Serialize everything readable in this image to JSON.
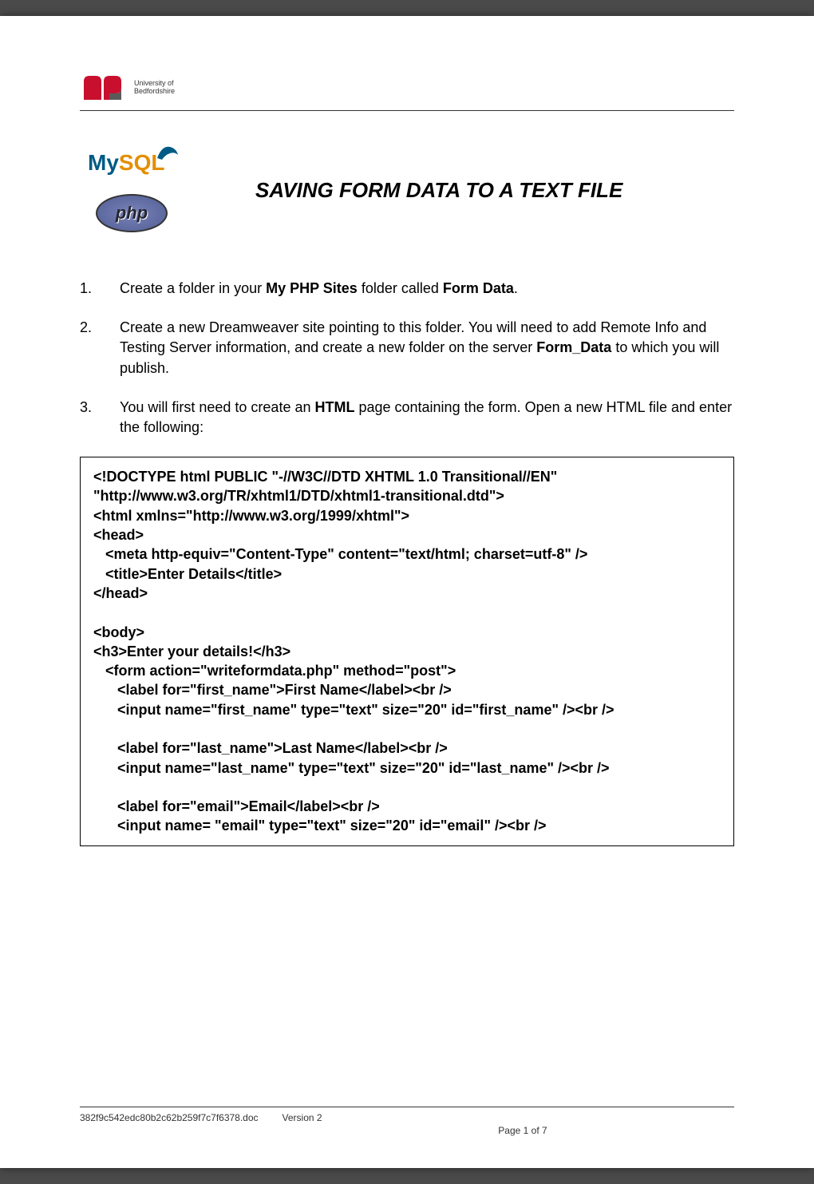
{
  "header": {
    "logo_line1": "University of",
    "logo_line2": "Bedfordshire"
  },
  "title": "SAVING FORM DATA TO A TEXT FILE",
  "tech_logos": {
    "mysql": "MySQL",
    "php": "php"
  },
  "instructions": [
    {
      "number": "1.",
      "segments": [
        {
          "text": "Create a folder in your ",
          "bold": false
        },
        {
          "text": "My PHP Sites",
          "bold": true
        },
        {
          "text": " folder called ",
          "bold": false
        },
        {
          "text": "Form Data",
          "bold": true
        },
        {
          "text": ".",
          "bold": false
        }
      ]
    },
    {
      "number": "2.",
      "segments": [
        {
          "text": "Create a new Dreamweaver site pointing to this folder.  You will need to add Remote Info and Testing Server information, and create a new folder on the server ",
          "bold": false
        },
        {
          "text": "Form_Data",
          "bold": true
        },
        {
          "text": " to which you will publish.",
          "bold": false
        }
      ]
    },
    {
      "number": "3.",
      "segments": [
        {
          "text": "You will first need to create an ",
          "bold": false
        },
        {
          "text": "HTML",
          "bold": true
        },
        {
          "text": " page containing the form.  Open a new HTML file and enter the following:",
          "bold": false
        }
      ]
    }
  ],
  "code_block": "<!DOCTYPE html PUBLIC \"-//W3C//DTD XHTML 1.0 Transitional//EN\" \"http://www.w3.org/TR/xhtml1/DTD/xhtml1-transitional.dtd\">\n<html xmlns=\"http://www.w3.org/1999/xhtml\">\n<head>\n   <meta http-equiv=\"Content-Type\" content=\"text/html; charset=utf-8\" />\n   <title>Enter Details</title>\n</head>\n\n<body>\n<h3>Enter your details!</h3>\n   <form action=\"writeformdata.php\" method=\"post\">\n      <label for=\"first_name\">First Name</label><br />\n      <input name=\"first_name\" type=\"text\" size=\"20\" id=\"first_name\" /><br />\n\n      <label for=\"last_name\">Last Name</label><br />\n      <input name=\"last_name\" type=\"text\" size=\"20\" id=\"last_name\" /><br />\n\n      <label for=\"email\">Email</label><br />\n      <input name= \"email\" type=\"text\" size=\"20\" id=\"email\" /><br />\n",
  "footer": {
    "filename": "382f9c542edc80b2c62b259f7c7f6378.doc",
    "version": "Version 2",
    "page": "Page 1 of 7"
  }
}
